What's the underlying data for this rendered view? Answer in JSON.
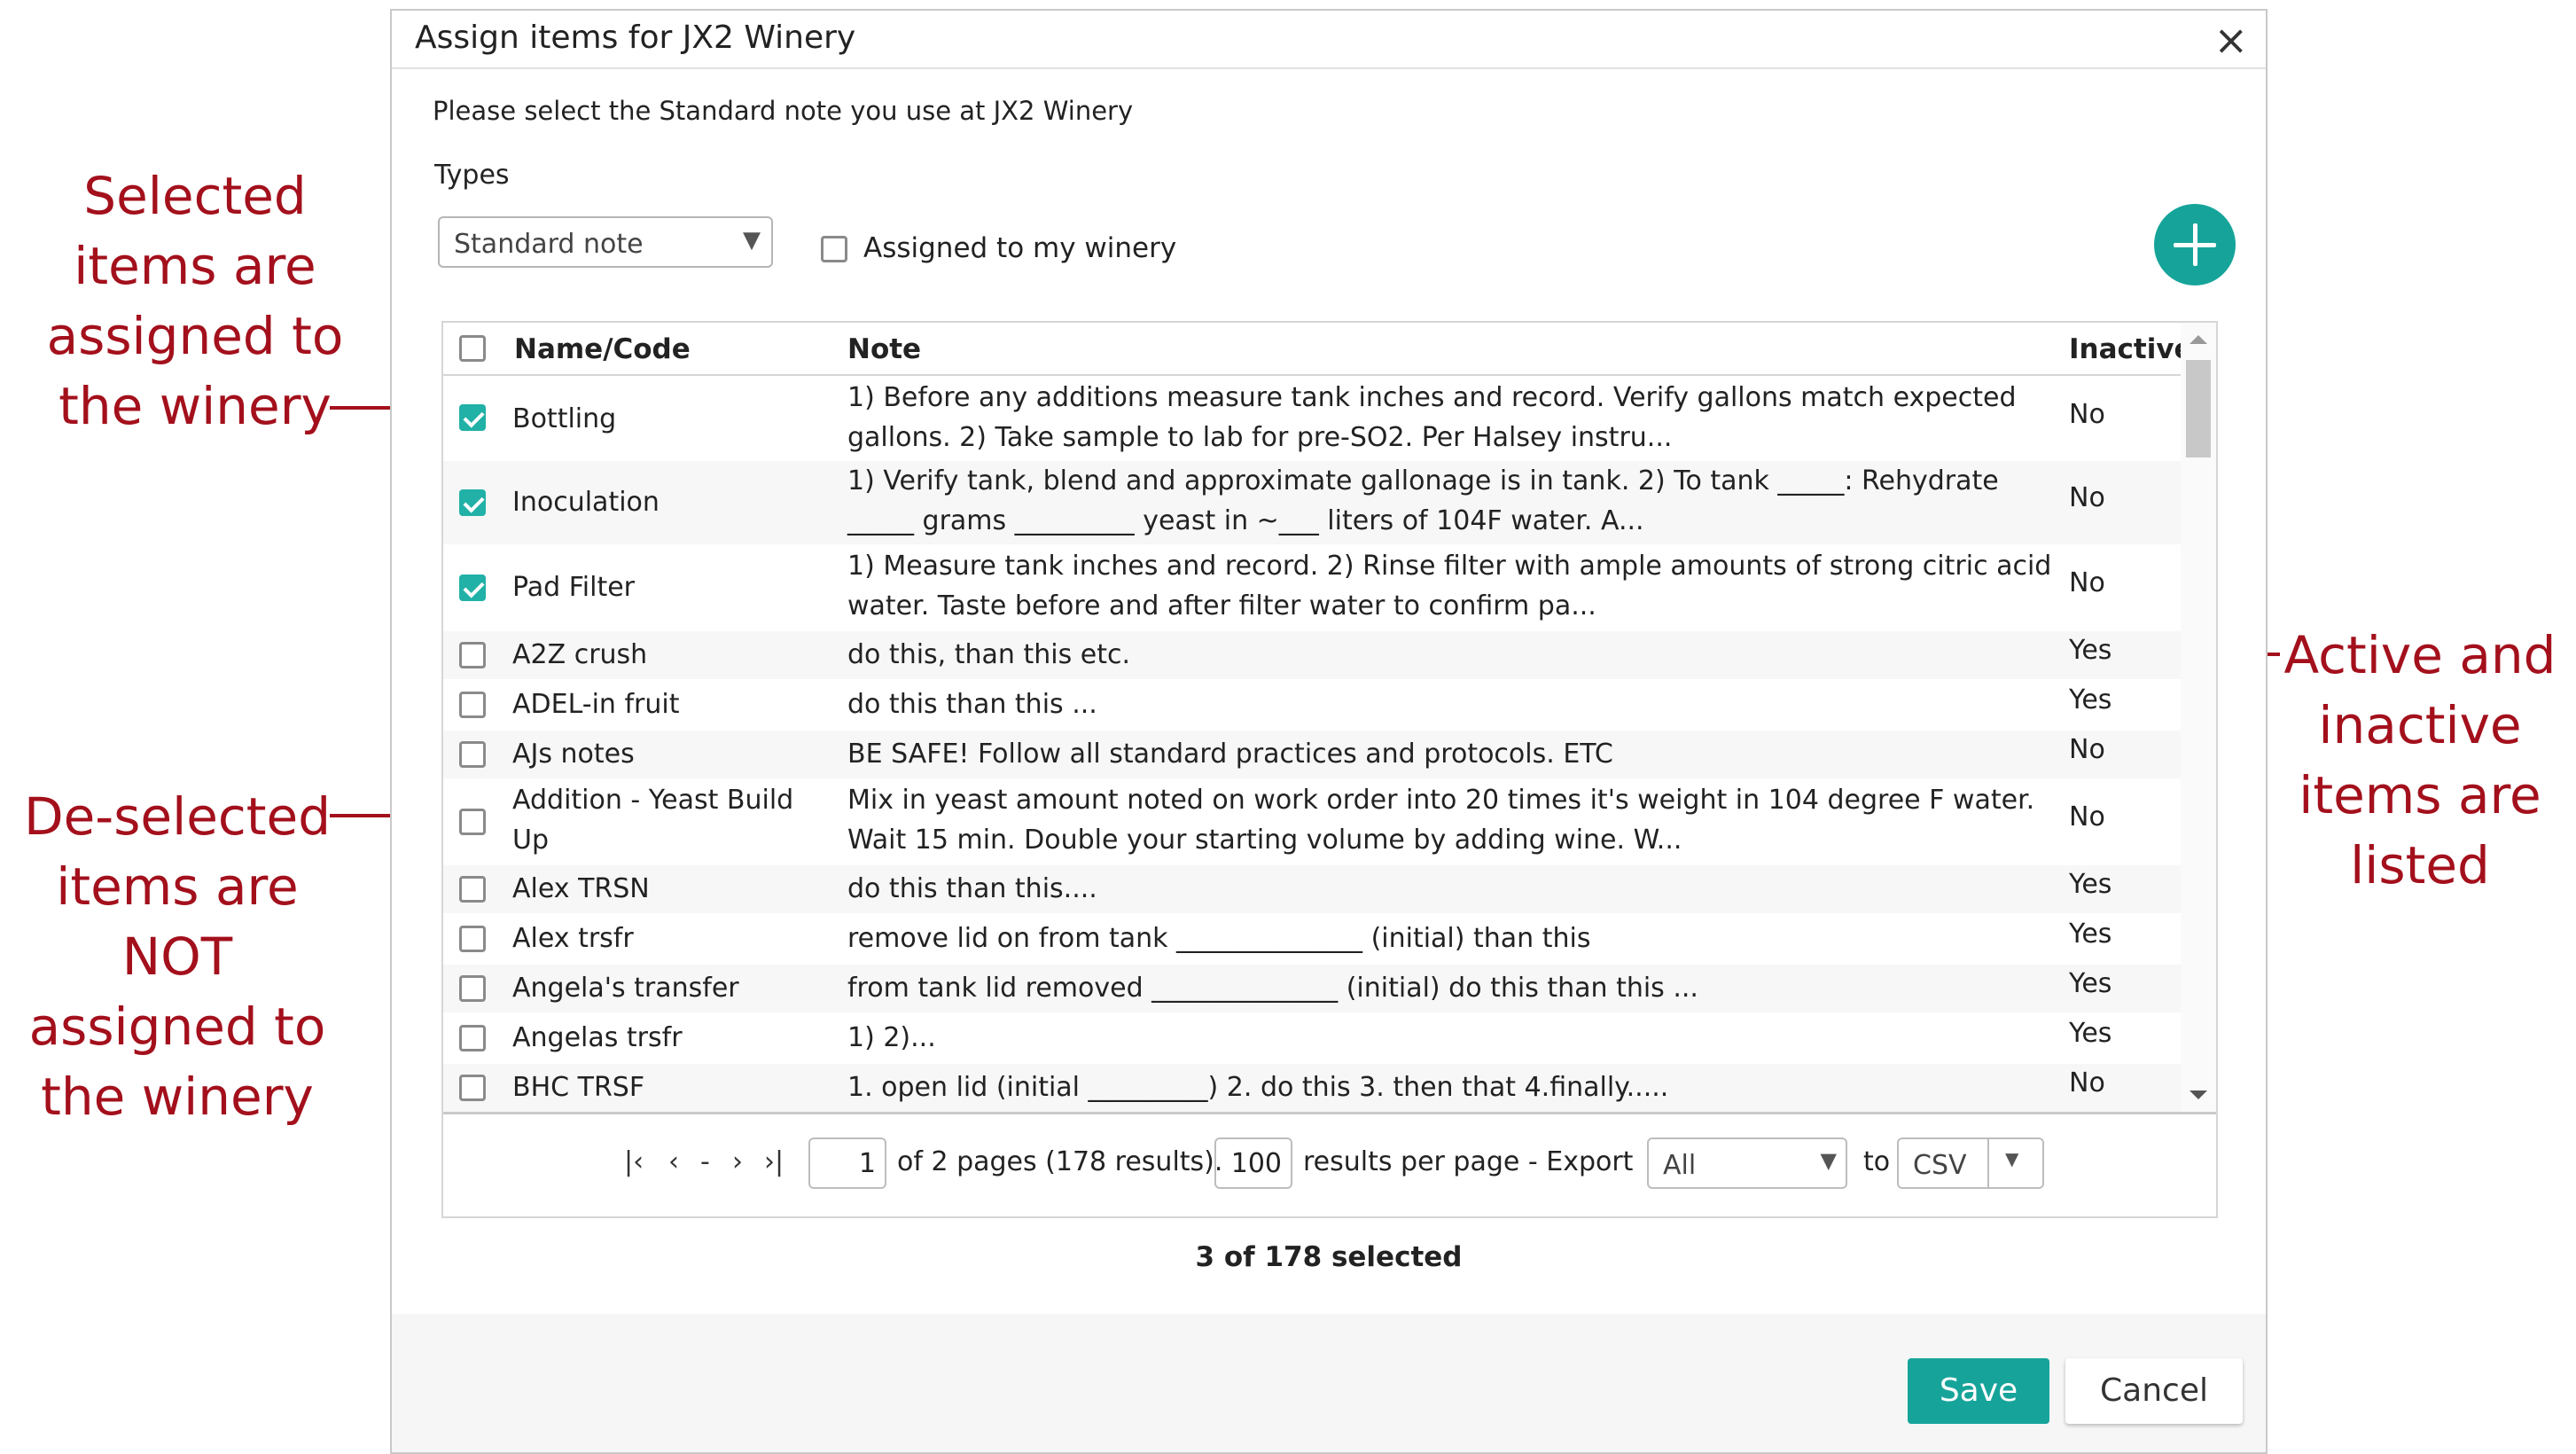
{
  "annotations": {
    "selected": "Selected\nitems are\nassigned to\nthe winery",
    "deselected": "De-selected\nitems are\nNOT\nassigned to\nthe winery",
    "active": "Active and\ninactive\nitems are\nlisted"
  },
  "dialog": {
    "title": "Assign items for JX2 Winery",
    "close_icon": "×",
    "prompt": "Please select the Standard note you use at JX2 Winery",
    "types_label": "Types",
    "type_select_value": "Standard note",
    "assigned_filter_label": "Assigned to my winery",
    "add_button_icon": "plus-icon"
  },
  "grid": {
    "columns": {
      "name": "Name/Code",
      "note": "Note",
      "inactive": "Inactive"
    },
    "rows": [
      {
        "checked": true,
        "name": "Bottling",
        "note": "1) Before any additions measure tank inches and record. Verify gallons match expected gallons. 2) Take sample to lab for pre-SO2. Per Halsey instru...",
        "inactive": "No"
      },
      {
        "checked": true,
        "name": "Inoculation",
        "note": "1) Verify tank, blend and approximate gallonage is in tank. 2) To tank _____: Rehydrate _____ grams _________ yeast in ~___ liters of 104F water. A...",
        "inactive": "No"
      },
      {
        "checked": true,
        "name": "Pad Filter",
        "note": "1) Measure tank inches and record. 2) Rinse filter with ample amounts of strong citric acid water. Taste before and after filter water to confirm pa...",
        "inactive": "No"
      },
      {
        "checked": false,
        "name": "A2Z crush",
        "note": "do this, than this etc.",
        "inactive": "Yes"
      },
      {
        "checked": false,
        "name": "ADEL-in fruit",
        "note": "do this than this ...",
        "inactive": "Yes"
      },
      {
        "checked": false,
        "name": "AJs notes",
        "note": "BE SAFE! Follow all standard practices and protocols. ETC",
        "inactive": "No"
      },
      {
        "checked": false,
        "name": "Addition - Yeast Build Up",
        "note": "Mix in yeast amount noted on work order into 20 times it's weight in 104 degree F water. Wait 15 min. Double your starting volume by adding wine. W...",
        "inactive": "No"
      },
      {
        "checked": false,
        "name": "Alex TRSN",
        "note": "do this than this....",
        "inactive": "Yes"
      },
      {
        "checked": false,
        "name": "Alex trsfr",
        "note": "remove lid on from tank ______________ (initial) than this",
        "inactive": "Yes"
      },
      {
        "checked": false,
        "name": "Angela's transfer",
        "note": "from tank lid removed ______________ (initial) do this than this ...",
        "inactive": "Yes"
      },
      {
        "checked": false,
        "name": "Angelas trsfr",
        "note": "1) 2)...",
        "inactive": "Yes"
      },
      {
        "checked": false,
        "name": "BHC TRSF",
        "note": "1. open lid (initial _________) 2. do this 3. then that 4.finally.....",
        "inactive": "No"
      }
    ]
  },
  "pager": {
    "first": "|‹",
    "prev": "‹",
    "dash": "-",
    "next": "›",
    "last": "›|",
    "page_value": "1",
    "pages_text": "of 2 pages (178 results).",
    "per_page_value": "100",
    "per_page_text": "results per page - Export",
    "export_scope": "All",
    "to_text": "to",
    "export_format": "CSV"
  },
  "selected_count": "3 of 178 selected",
  "footer": {
    "save_label": "Save",
    "cancel_label": "Cancel"
  },
  "colors": {
    "accent": "#16a49a",
    "annotation": "#a3101c"
  }
}
